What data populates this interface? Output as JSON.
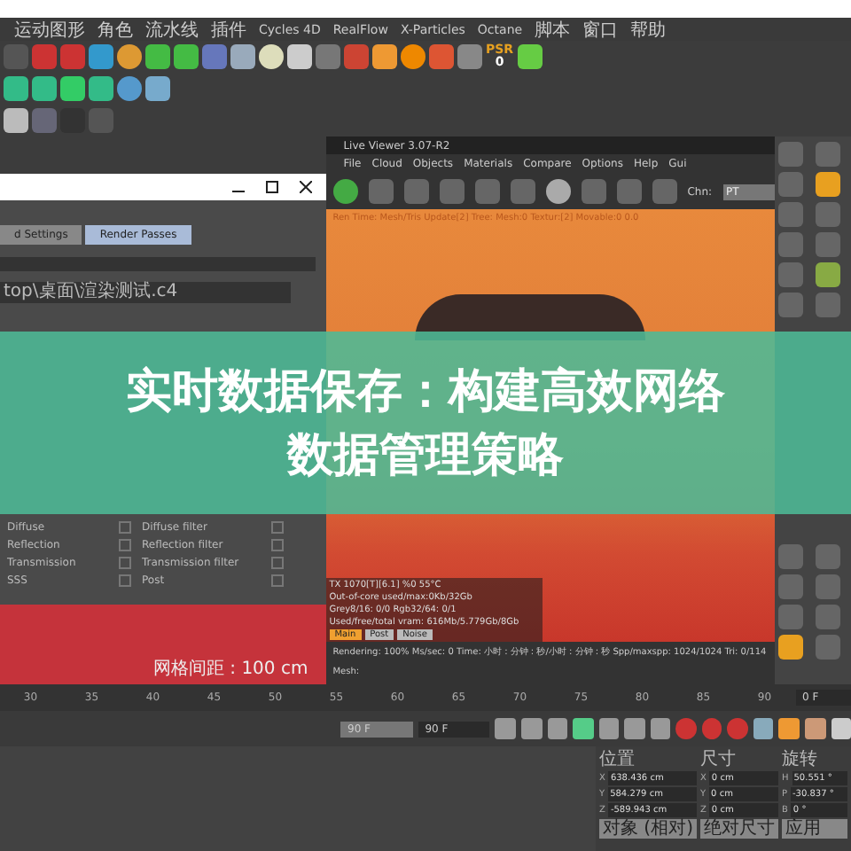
{
  "menu_bar": [
    "运动图形",
    "角色",
    "流水线",
    "插件",
    "Cycles 4D",
    "RealFlow",
    "X-Particles",
    "Octane",
    "脚本",
    "窗口",
    "帮助"
  ],
  "toolbar_badge": {
    "label": "PSR",
    "value": "0"
  },
  "settings_dialog": {
    "tabs": [
      {
        "label": "d Settings",
        "selected": false
      },
      {
        "label": "Render Passes",
        "selected": true
      }
    ],
    "path": "top\\桌面\\渲染测试.c4",
    "passes": [
      {
        "left": "Diffuse",
        "right": "Diffuse filter"
      },
      {
        "left": "Reflection",
        "right": "Reflection filter"
      },
      {
        "left": "Transmission",
        "right": "Transmission filter"
      },
      {
        "left": "SSS",
        "right": "Post"
      }
    ]
  },
  "viewport_label": "网格间距 : 100 cm",
  "live_viewer": {
    "title": "Live Viewer 3.07-R2",
    "menu": [
      "File",
      "Cloud",
      "Objects",
      "Materials",
      "Compare",
      "Options",
      "Help",
      "Gui"
    ],
    "channel_label": "Chn:",
    "channel_value": "PT",
    "status": "Ren Time: Mesh/Tris Update[2] Tree: Mesh:0 Textur:[2] Movable:0 0.0",
    "stats": [
      "TX 1070[T][6.1]   %0   55°C",
      "Out-of-core used/max:0Kb/32Gb",
      "Grey8/16: 0/0   Rgb32/64: 0/1",
      "Used/free/total vram: 616Mb/5.779Gb/8Gb"
    ],
    "stat_tabs": [
      {
        "label": "Main",
        "selected": true
      },
      {
        "label": "Post",
        "selected": false
      },
      {
        "label": "Noise",
        "selected": false
      }
    ],
    "rendering_line": "Rendering: 100%   Ms/sec: 0   Time: 小时 : 分钟 : 秒/小时 : 分钟 : 秒   Spp/maxspp: 1024/1024   Tri: 0/114   Mesh:"
  },
  "timeline": {
    "ticks": [
      "30",
      "35",
      "40",
      "45",
      "50",
      "55",
      "60",
      "65",
      "70",
      "75",
      "80",
      "85",
      "90"
    ],
    "current_frame": "0 F",
    "start_field": "90 F",
    "end_field": "90 F"
  },
  "coordinates": {
    "headers": [
      "位置",
      "尺寸",
      "旋转"
    ],
    "rows": [
      {
        "axis": "X",
        "position": "638.436 cm",
        "size_axis": "X",
        "size": "0 cm",
        "rot_axis": "H",
        "rotation": "50.551 °"
      },
      {
        "axis": "Y",
        "position": "584.279 cm",
        "size_axis": "Y",
        "size": "0 cm",
        "rot_axis": "P",
        "rotation": "-30.837 °"
      },
      {
        "axis": "Z",
        "position": "-589.943 cm",
        "size_axis": "Z",
        "size": "0 cm",
        "rot_axis": "B",
        "rotation": "0 °"
      }
    ],
    "mode_dropdown": "对象 (相对)",
    "size_dropdown": "绝对尺寸",
    "apply_button": "应用"
  },
  "banner": {
    "lines": [
      "实时数据保存：构建高效网络",
      "数据管理策略"
    ]
  }
}
